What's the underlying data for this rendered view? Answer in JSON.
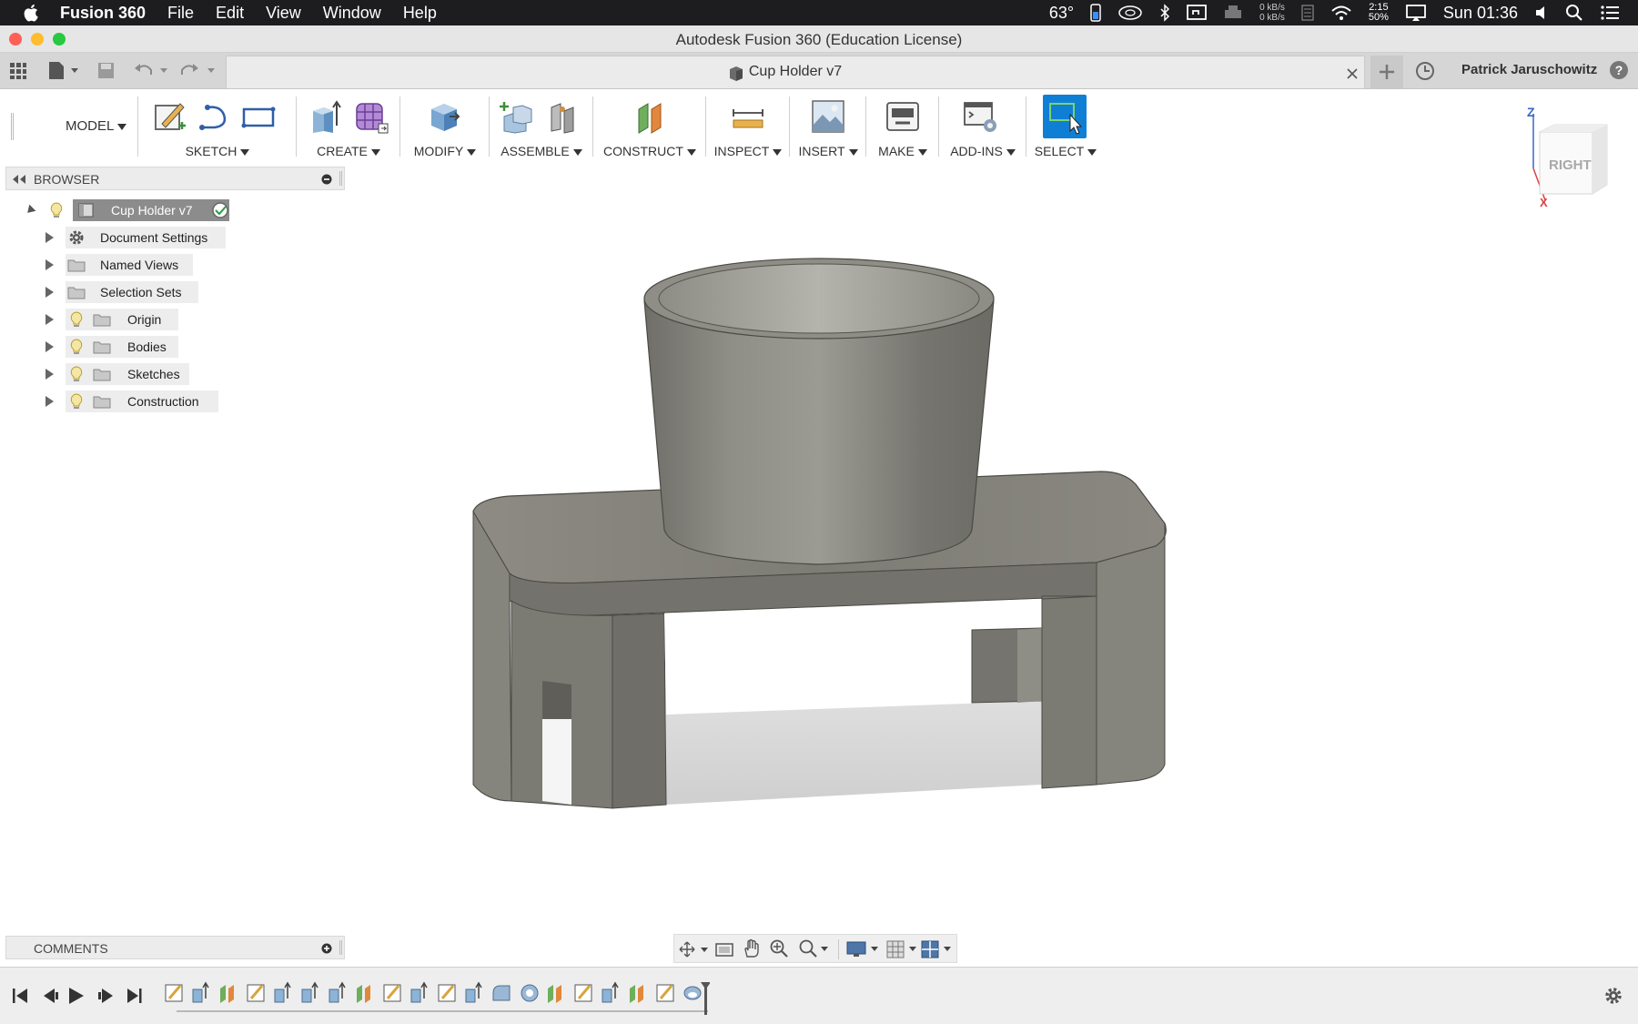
{
  "menubar": {
    "app_name": "Fusion 360",
    "items": [
      "File",
      "Edit",
      "View",
      "Window",
      "Help"
    ],
    "temperature": "63°",
    "net_up": "0 kB/s",
    "net_down": "0 kB/s",
    "battery_time": "2:15",
    "battery_pct": "50%",
    "clock": "Sun 01:36"
  },
  "window": {
    "title": "Autodesk Fusion 360 (Education License)"
  },
  "tabbar": {
    "doc_title": "Cup Holder v7",
    "user": "Patrick Jaruschowitz"
  },
  "toolbar": {
    "workspace": "MODEL",
    "groups": [
      "SKETCH",
      "CREATE",
      "MODIFY",
      "ASSEMBLE",
      "CONSTRUCT",
      "INSPECT",
      "INSERT",
      "MAKE",
      "ADD-INS",
      "SELECT"
    ]
  },
  "browser": {
    "title": "BROWSER",
    "root": "Cup Holder v7",
    "items": [
      "Document Settings",
      "Named Views",
      "Selection Sets",
      "Origin",
      "Bodies",
      "Sketches",
      "Construction"
    ]
  },
  "comments": {
    "title": "COMMENTS"
  },
  "viewcube": {
    "face": "RIGHT",
    "axis_z": "Z",
    "axis_x": "X"
  },
  "colors": {
    "select_active": "#0f7fd6",
    "model_body": "#7c7b74",
    "menubar_bg": "#1d1d1f"
  }
}
